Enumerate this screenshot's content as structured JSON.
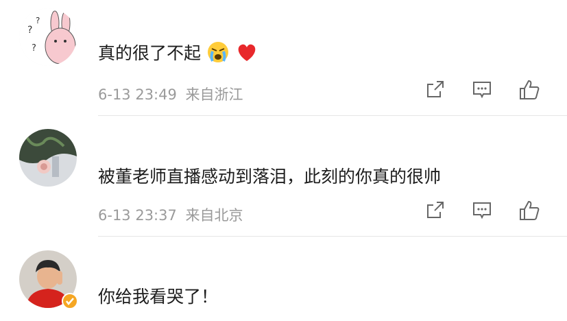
{
  "comments": [
    {
      "text": "真的很了不起",
      "emojis": [
        "crying-face-emoji",
        "red-heart-emoji"
      ],
      "time": "6-13 23:49",
      "location": "来自浙江",
      "avatar": "bunny-avatar"
    },
    {
      "text": "被董老师直播感动到落泪，此刻的你真的很帅",
      "emojis": [],
      "time": "6-13 23:37",
      "location": "来自北京",
      "avatar": "flower-avatar"
    },
    {
      "text": "你给我看哭了！",
      "emojis": [],
      "verified_badge": true,
      "avatar": "athlete-avatar"
    }
  ],
  "icons": {
    "share": "share-icon",
    "comment": "comment-icon",
    "like": "like-icon"
  },
  "colors": {
    "text": "#1d1d1d",
    "meta": "#9a9a9a",
    "divider": "#e6e6e6",
    "verified": "#f5a623"
  }
}
